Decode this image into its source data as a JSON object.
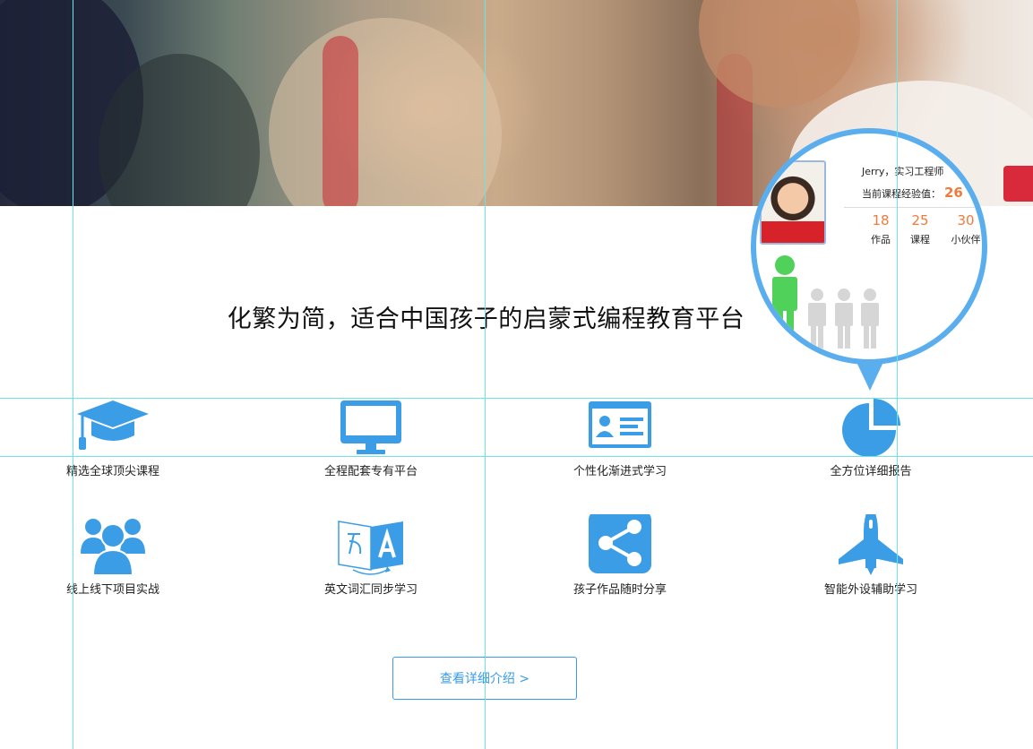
{
  "slogan": "化繁为简，适合中国孩子的启蒙式编程教育平台",
  "features": [
    {
      "label": "精选全球顶尖课程",
      "icon": "graduation-cap-icon"
    },
    {
      "label": "全程配套专有平台",
      "icon": "monitor-icon"
    },
    {
      "label": "个性化渐进式学习",
      "icon": "id-card-icon"
    },
    {
      "label": "全方位详细报告",
      "icon": "pie-chart-icon"
    },
    {
      "label": "线上线下项目实战",
      "icon": "group-icon"
    },
    {
      "label": "英文词汇同步学习",
      "icon": "translate-icon"
    },
    {
      "label": "孩子作品随时分享",
      "icon": "share-icon"
    },
    {
      "label": "智能外设辅助学习",
      "icon": "rocket-icon"
    }
  ],
  "detail_button": "查看详细介绍 >",
  "profile_card": {
    "name_line": "Jerry，实习工程师",
    "exp_label": "当前课程经验值：",
    "exp_value": "26",
    "stats": [
      {
        "value": "18",
        "label": "作品"
      },
      {
        "value": "25",
        "label": "课程"
      },
      {
        "value": "30",
        "label": "小伙伴"
      }
    ]
  },
  "colors": {
    "icon_blue": "#3b9de5",
    "accent_orange": "#f07a3a",
    "bubble_border": "#5aaeee",
    "guide_cyan": "#6be3e8",
    "person_green": "#4fd15a",
    "person_gray": "#d6d6d6"
  }
}
